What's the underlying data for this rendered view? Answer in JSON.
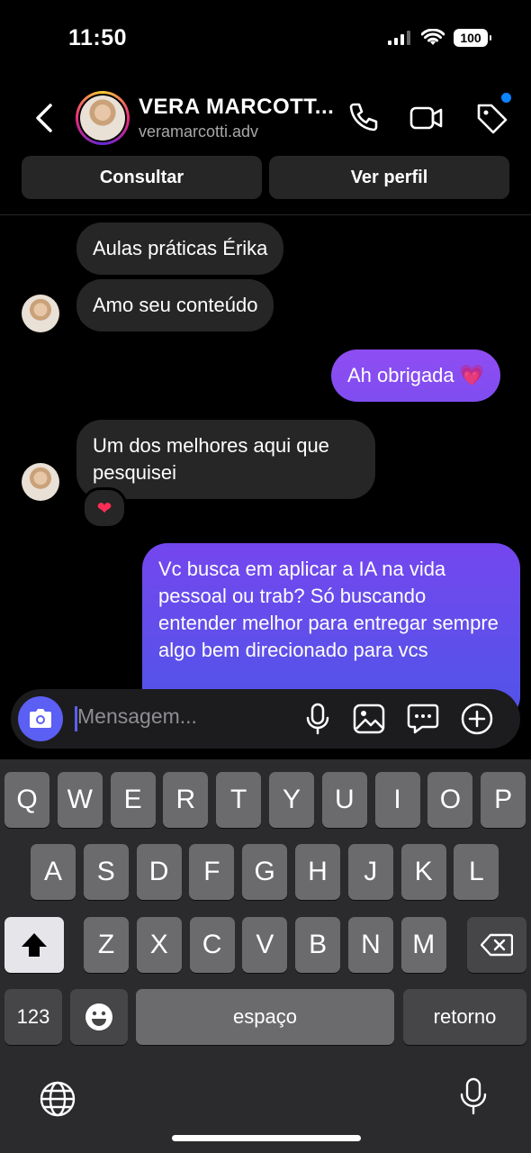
{
  "status_bar": {
    "time": "11:50",
    "battery": "100"
  },
  "header": {
    "back_icon": "chevron-left-icon",
    "contact_name": "VERA MARCOTT...",
    "username": "veramarcotti.adv",
    "call_icon": "phone-icon",
    "video_icon": "video-camera-icon",
    "tag_icon": "tag-icon",
    "notification_color": "#0a84ff"
  },
  "actions": {
    "consult_label": "Consultar",
    "profile_label": "Ver perfil"
  },
  "messages": [
    {
      "direction": "in",
      "text": "Aulas práticas  Érika"
    },
    {
      "direction": "in",
      "text": "Amo seu conteúdo"
    },
    {
      "direction": "out",
      "text": "Ah obrigada 💗"
    },
    {
      "direction": "in",
      "text": "Um dos melhores aqui que pesquisei",
      "reaction": "❤"
    },
    {
      "direction": "out",
      "text": "Vc busca em aplicar a IA na vida pessoal ou trab? Só buscando entender melhor para entregar sempre algo bem direcionado para vcs"
    }
  ],
  "composer": {
    "placeholder": "Mensagem..."
  },
  "keyboard": {
    "row1": [
      "Q",
      "W",
      "E",
      "R",
      "T",
      "Y",
      "U",
      "I",
      "O",
      "P"
    ],
    "row2": [
      "A",
      "S",
      "D",
      "F",
      "G",
      "H",
      "J",
      "K",
      "L"
    ],
    "row3": [
      "Z",
      "X",
      "C",
      "V",
      "B",
      "N",
      "M"
    ],
    "numbers_label": "123",
    "space_label": "espaço",
    "return_label": "retorno"
  },
  "colors": {
    "outgoing_bubble_top": "#8a4cf0",
    "outgoing_bubble_bottom": "#4f55e8",
    "incoming_bubble": "#262626",
    "accent": "#5b5ff3"
  }
}
